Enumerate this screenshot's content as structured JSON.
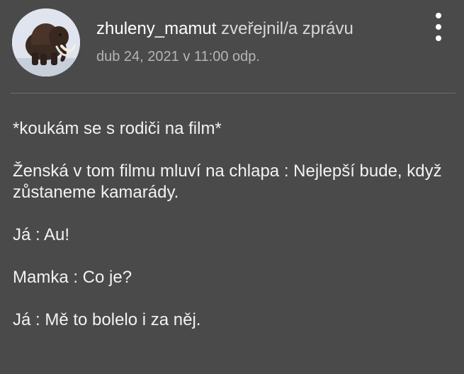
{
  "post": {
    "author": "zhuleny_mamut",
    "action": " zveřejnil/a zprávu",
    "date": "dub 24, 2021 v 11:00 odp.",
    "avatar_icon": "mammoth-avatar",
    "menu_icon": "more-vertical-icon",
    "body": [
      "*koukám se s rodiči na film*",
      "Ženská v tom filmu mluví na chlapa : Nejlepší bude, když zůstaneme kamarády.",
      "Já : Au!",
      "Mamka : Co je?",
      "Já : Mě to bolelo i za něj."
    ]
  },
  "colors": {
    "background": "#4a4a4a",
    "text": "#f2f2f2",
    "secondary_text": "#b4b4b4"
  }
}
